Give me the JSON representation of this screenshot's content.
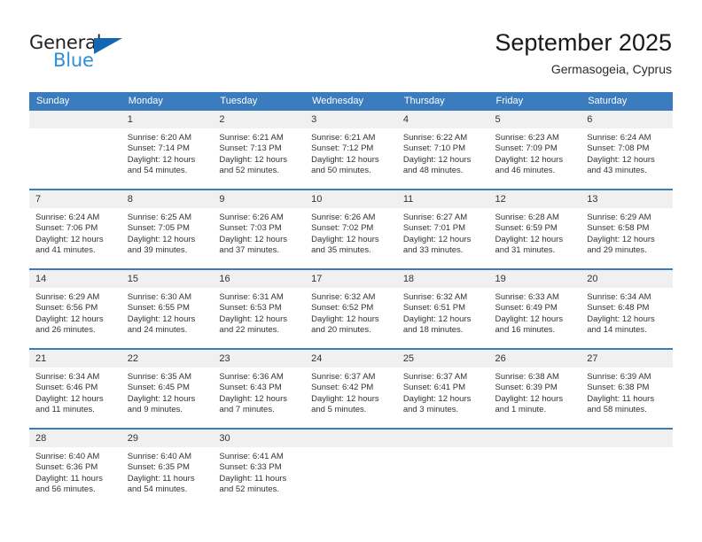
{
  "brand": {
    "name_part1": "General",
    "name_part2": "Blue",
    "triangle_color": "#1267b2",
    "blue_color": "#2f8fd6"
  },
  "header": {
    "title": "September 2025",
    "subtitle": "Germasogeia, Cyprus"
  },
  "theme": {
    "header_bg": "#3a7cbe",
    "header_text": "#ffffff",
    "daynum_band_bg": "#f0f0f0",
    "row_separator": "#3a7cbe",
    "body_text": "#333333"
  },
  "calendar": {
    "weekday_headers": [
      "Sunday",
      "Monday",
      "Tuesday",
      "Wednesday",
      "Thursday",
      "Friday",
      "Saturday"
    ],
    "weeks": [
      [
        {
          "day": "",
          "empty": true,
          "sunrise": "",
          "sunset": "",
          "daylight_line1": "",
          "daylight_line2": ""
        },
        {
          "day": "1",
          "sunrise": "Sunrise: 6:20 AM",
          "sunset": "Sunset: 7:14 PM",
          "daylight_line1": "Daylight: 12 hours",
          "daylight_line2": "and 54 minutes."
        },
        {
          "day": "2",
          "sunrise": "Sunrise: 6:21 AM",
          "sunset": "Sunset: 7:13 PM",
          "daylight_line1": "Daylight: 12 hours",
          "daylight_line2": "and 52 minutes."
        },
        {
          "day": "3",
          "sunrise": "Sunrise: 6:21 AM",
          "sunset": "Sunset: 7:12 PM",
          "daylight_line1": "Daylight: 12 hours",
          "daylight_line2": "and 50 minutes."
        },
        {
          "day": "4",
          "sunrise": "Sunrise: 6:22 AM",
          "sunset": "Sunset: 7:10 PM",
          "daylight_line1": "Daylight: 12 hours",
          "daylight_line2": "and 48 minutes."
        },
        {
          "day": "5",
          "sunrise": "Sunrise: 6:23 AM",
          "sunset": "Sunset: 7:09 PM",
          "daylight_line1": "Daylight: 12 hours",
          "daylight_line2": "and 46 minutes."
        },
        {
          "day": "6",
          "sunrise": "Sunrise: 6:24 AM",
          "sunset": "Sunset: 7:08 PM",
          "daylight_line1": "Daylight: 12 hours",
          "daylight_line2": "and 43 minutes."
        }
      ],
      [
        {
          "day": "7",
          "sunrise": "Sunrise: 6:24 AM",
          "sunset": "Sunset: 7:06 PM",
          "daylight_line1": "Daylight: 12 hours",
          "daylight_line2": "and 41 minutes."
        },
        {
          "day": "8",
          "sunrise": "Sunrise: 6:25 AM",
          "sunset": "Sunset: 7:05 PM",
          "daylight_line1": "Daylight: 12 hours",
          "daylight_line2": "and 39 minutes."
        },
        {
          "day": "9",
          "sunrise": "Sunrise: 6:26 AM",
          "sunset": "Sunset: 7:03 PM",
          "daylight_line1": "Daylight: 12 hours",
          "daylight_line2": "and 37 minutes."
        },
        {
          "day": "10",
          "sunrise": "Sunrise: 6:26 AM",
          "sunset": "Sunset: 7:02 PM",
          "daylight_line1": "Daylight: 12 hours",
          "daylight_line2": "and 35 minutes."
        },
        {
          "day": "11",
          "sunrise": "Sunrise: 6:27 AM",
          "sunset": "Sunset: 7:01 PM",
          "daylight_line1": "Daylight: 12 hours",
          "daylight_line2": "and 33 minutes."
        },
        {
          "day": "12",
          "sunrise": "Sunrise: 6:28 AM",
          "sunset": "Sunset: 6:59 PM",
          "daylight_line1": "Daylight: 12 hours",
          "daylight_line2": "and 31 minutes."
        },
        {
          "day": "13",
          "sunrise": "Sunrise: 6:29 AM",
          "sunset": "Sunset: 6:58 PM",
          "daylight_line1": "Daylight: 12 hours",
          "daylight_line2": "and 29 minutes."
        }
      ],
      [
        {
          "day": "14",
          "sunrise": "Sunrise: 6:29 AM",
          "sunset": "Sunset: 6:56 PM",
          "daylight_line1": "Daylight: 12 hours",
          "daylight_line2": "and 26 minutes."
        },
        {
          "day": "15",
          "sunrise": "Sunrise: 6:30 AM",
          "sunset": "Sunset: 6:55 PM",
          "daylight_line1": "Daylight: 12 hours",
          "daylight_line2": "and 24 minutes."
        },
        {
          "day": "16",
          "sunrise": "Sunrise: 6:31 AM",
          "sunset": "Sunset: 6:53 PM",
          "daylight_line1": "Daylight: 12 hours",
          "daylight_line2": "and 22 minutes."
        },
        {
          "day": "17",
          "sunrise": "Sunrise: 6:32 AM",
          "sunset": "Sunset: 6:52 PM",
          "daylight_line1": "Daylight: 12 hours",
          "daylight_line2": "and 20 minutes."
        },
        {
          "day": "18",
          "sunrise": "Sunrise: 6:32 AM",
          "sunset": "Sunset: 6:51 PM",
          "daylight_line1": "Daylight: 12 hours",
          "daylight_line2": "and 18 minutes."
        },
        {
          "day": "19",
          "sunrise": "Sunrise: 6:33 AM",
          "sunset": "Sunset: 6:49 PM",
          "daylight_line1": "Daylight: 12 hours",
          "daylight_line2": "and 16 minutes."
        },
        {
          "day": "20",
          "sunrise": "Sunrise: 6:34 AM",
          "sunset": "Sunset: 6:48 PM",
          "daylight_line1": "Daylight: 12 hours",
          "daylight_line2": "and 14 minutes."
        }
      ],
      [
        {
          "day": "21",
          "sunrise": "Sunrise: 6:34 AM",
          "sunset": "Sunset: 6:46 PM",
          "daylight_line1": "Daylight: 12 hours",
          "daylight_line2": "and 11 minutes."
        },
        {
          "day": "22",
          "sunrise": "Sunrise: 6:35 AM",
          "sunset": "Sunset: 6:45 PM",
          "daylight_line1": "Daylight: 12 hours",
          "daylight_line2": "and 9 minutes."
        },
        {
          "day": "23",
          "sunrise": "Sunrise: 6:36 AM",
          "sunset": "Sunset: 6:43 PM",
          "daylight_line1": "Daylight: 12 hours",
          "daylight_line2": "and 7 minutes."
        },
        {
          "day": "24",
          "sunrise": "Sunrise: 6:37 AM",
          "sunset": "Sunset: 6:42 PM",
          "daylight_line1": "Daylight: 12 hours",
          "daylight_line2": "and 5 minutes."
        },
        {
          "day": "25",
          "sunrise": "Sunrise: 6:37 AM",
          "sunset": "Sunset: 6:41 PM",
          "daylight_line1": "Daylight: 12 hours",
          "daylight_line2": "and 3 minutes."
        },
        {
          "day": "26",
          "sunrise": "Sunrise: 6:38 AM",
          "sunset": "Sunset: 6:39 PM",
          "daylight_line1": "Daylight: 12 hours",
          "daylight_line2": "and 1 minute."
        },
        {
          "day": "27",
          "sunrise": "Sunrise: 6:39 AM",
          "sunset": "Sunset: 6:38 PM",
          "daylight_line1": "Daylight: 11 hours",
          "daylight_line2": "and 58 minutes."
        }
      ],
      [
        {
          "day": "28",
          "sunrise": "Sunrise: 6:40 AM",
          "sunset": "Sunset: 6:36 PM",
          "daylight_line1": "Daylight: 11 hours",
          "daylight_line2": "and 56 minutes."
        },
        {
          "day": "29",
          "sunrise": "Sunrise: 6:40 AM",
          "sunset": "Sunset: 6:35 PM",
          "daylight_line1": "Daylight: 11 hours",
          "daylight_line2": "and 54 minutes."
        },
        {
          "day": "30",
          "sunrise": "Sunrise: 6:41 AM",
          "sunset": "Sunset: 6:33 PM",
          "daylight_line1": "Daylight: 11 hours",
          "daylight_line2": "and 52 minutes."
        },
        {
          "day": "",
          "empty": true,
          "sunrise": "",
          "sunset": "",
          "daylight_line1": "",
          "daylight_line2": ""
        },
        {
          "day": "",
          "empty": true,
          "sunrise": "",
          "sunset": "",
          "daylight_line1": "",
          "daylight_line2": ""
        },
        {
          "day": "",
          "empty": true,
          "sunrise": "",
          "sunset": "",
          "daylight_line1": "",
          "daylight_line2": ""
        },
        {
          "day": "",
          "empty": true,
          "sunrise": "",
          "sunset": "",
          "daylight_line1": "",
          "daylight_line2": ""
        }
      ]
    ]
  }
}
